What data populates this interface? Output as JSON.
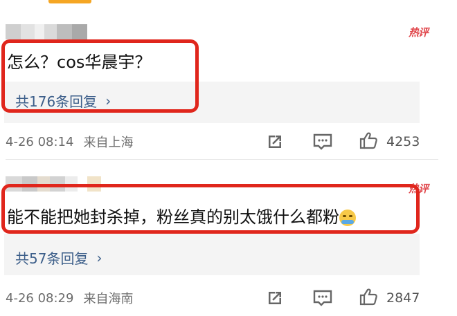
{
  "colors": {
    "accent": "#f5a623",
    "hot_badge": "#e0464b",
    "highlight_frame": "#e0261c",
    "reply_link": "#3d5f8a",
    "meta_text": "#6b6b6b"
  },
  "comments": [
    {
      "badge": "热评",
      "text": "怎么？cos华晨宇？",
      "reply_link": "共176条回复",
      "time": "4-26 08:14",
      "location": "来自上海",
      "likes": "4253",
      "icons": [
        "share-icon",
        "comment-icon",
        "like-icon"
      ]
    },
    {
      "badge": "热评",
      "text": "能不能把她封杀掉，粉丝真的别太饿什么都粉",
      "emoji": "crying-face-emoji",
      "reply_link": "共57条回复",
      "time": "4-26 08:29",
      "location": "来自海南",
      "likes": "2847",
      "icons": [
        "share-icon",
        "comment-icon",
        "like-icon"
      ]
    }
  ]
}
